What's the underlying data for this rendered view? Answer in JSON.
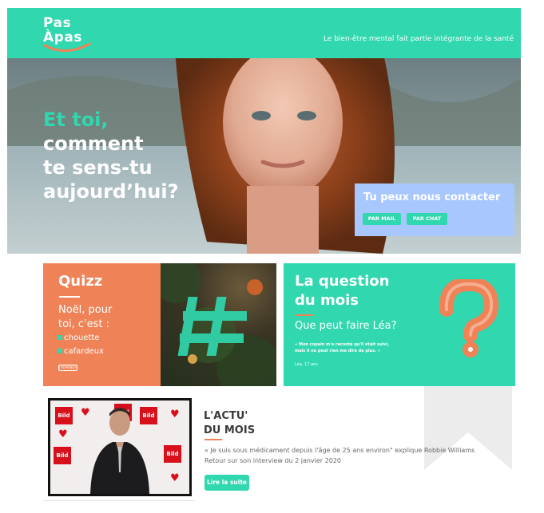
{
  "header": {
    "logo_line1": "Pas",
    "logo_line2": "Àpas",
    "tagline": "Le bien-être mental fait partie intégrante de la santé"
  },
  "hero": {
    "title_accent": "Et toi,",
    "title_line2": "comment",
    "title_line3": "te sens-tu",
    "title_line4": "aujourd’hui?",
    "contact_title": "Tu peux nous contacter",
    "mail_button": "PAR MAIL",
    "chat_button": "PAR CHAT"
  },
  "quiz": {
    "title": "Quizz",
    "question_line1": "Noël, pour",
    "question_line2": "toi, c'est :",
    "option1": "chouette",
    "option2": "cafardeux",
    "vote_label": "J'RÉPONDS"
  },
  "question": {
    "title": "La question du mois",
    "subtitle": "Que peut faire Léa?",
    "quote": "« Mon copain m'a raconté qu'il était suivi, mais il ne peut rien me dire de plus. »",
    "author": "Léa, 17 ans"
  },
  "actu": {
    "title_line1": "L'ACTU'",
    "title_line2": "DU MOIS",
    "text1": "« Je suis sous médicament depuis l'âge de 25 ans environ\" explique Robbie Williams",
    "text2": "Retour sur son interview du 2 janvier 2020",
    "button": "Lire la suite",
    "bild": "Bild"
  },
  "colors": {
    "brand_green": "#31d7ae",
    "brand_orange": "#ef8357",
    "contact_blue": "#a8c7ff"
  }
}
